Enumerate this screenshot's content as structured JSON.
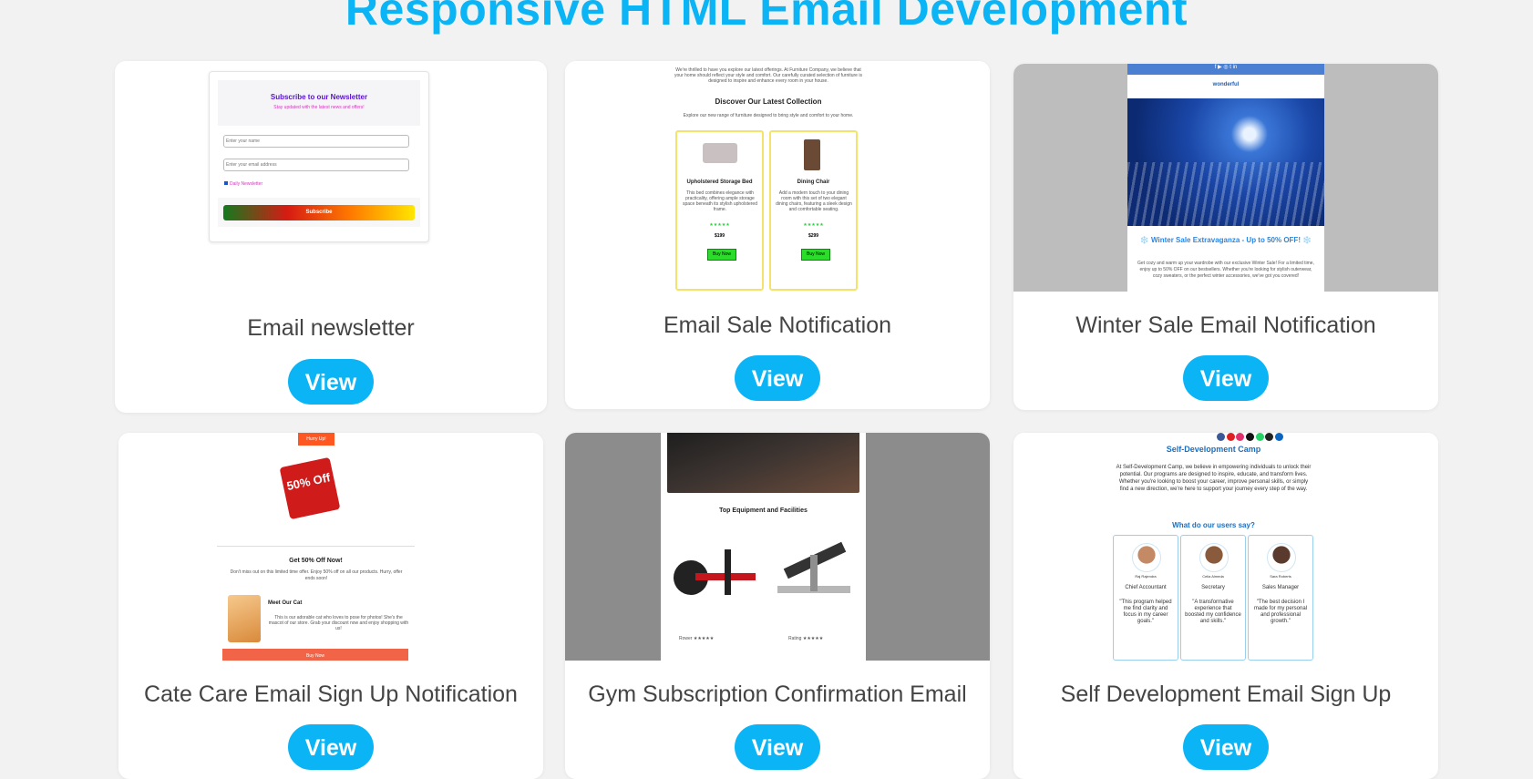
{
  "page": {
    "title": "Responsive HTML Email Development"
  },
  "cards": [
    {
      "title": "Email newsletter",
      "view_label": "View",
      "preview": {
        "heading": "Subscribe to our Newsletter",
        "subheading": "Stay updated with the latest news and offers!",
        "name_placeholder": "Enter your name",
        "email_placeholder": "Enter your email address",
        "checkbox_label": "Daily Newsletter",
        "button": "Subscribe"
      }
    },
    {
      "title": "Email Sale Notification",
      "view_label": "View",
      "preview": {
        "intro": "We're thrilled to have you explore our latest offerings. At Furniture Company, we believe that your home should reflect your style and comfort. Our carefully curated selection of furniture is designed to inspire and enhance every room in your house.",
        "heading": "Discover Our Latest Collection",
        "subtext": "Explore our new range of furniture designed to bring style and comfort to your home.",
        "products": [
          {
            "name": "Upholstered Storage Bed",
            "desc": "This bed combines elegance with practicality, offering ample storage space beneath its stylish upholstered frame.",
            "price": "$199",
            "button": "Buy Now"
          },
          {
            "name": "Dining Chair",
            "desc": "Add a modern touch to your dining room with this set of two elegant dining chairs, featuring a sleek design and comfortable seating.",
            "price": "$299",
            "button": "Buy Now"
          }
        ]
      }
    },
    {
      "title": "Winter Sale Email Notification",
      "view_label": "View",
      "preview": {
        "logo": "wonderful",
        "heading": "❄️ Winter Sale Extravaganza - Up to 50% OFF! ❄️",
        "body": "Get cozy and warm up your wardrobe with our exclusive Winter Sale! For a limited time, enjoy up to 50% OFF on our bestsellers. Whether you're looking for stylish outerwear, cozy sweaters, or the perfect winter accessories, we've got you covered!"
      }
    },
    {
      "title": "Cate Care Email Sign Up Notification",
      "view_label": "View",
      "preview": {
        "badge": "Hurry Up!",
        "tag_text": "50% Off",
        "heading": "Get 50% Off Now!",
        "body": "Don't miss out on this limited time offer. Enjoy 50% off on all our products. Hurry, offer ends soon!",
        "cat_heading": "Meet Our Cat",
        "cat_body": "This is our adorable cat who loves to pose for photos! She's the mascot of our store. Grab your discount now and enjoy shopping with us!",
        "button": "Buy Now"
      }
    },
    {
      "title": "Gym Subscription Confirmation Email",
      "view_label": "View",
      "preview": {
        "heading": "Top Equipment and Facilities",
        "caption_left": "Rower ★★★★★",
        "caption_right": "Rating ★★★★★"
      }
    },
    {
      "title": "Self Development Email Sign Up",
      "view_label": "View",
      "preview": {
        "heading": "Self-Development Camp",
        "body": "At Self-Development Camp, we believe in empowering individuals to unlock their potential. Our programs are designed to inspire, educate, and transform lives. Whether you're looking to boost your career, improve personal skills, or simply find a new direction, we're here to support your journey every step of the way.",
        "testimonials_heading": "What do our users say?",
        "testimonials": [
          {
            "name": "Raj Rajendra",
            "role": "Chief Accountant",
            "quote": "\"This program helped me find clarity and focus in my career goals.\""
          },
          {
            "name": "Celia Almeda",
            "role": "Secretary",
            "quote": "\"A transformative experience that boosted my confidence and skills.\""
          },
          {
            "name": "Sara Roberts",
            "role": "Sales Manager",
            "quote": "\"The best decision I made for my personal and professional growth.\""
          }
        ]
      }
    }
  ],
  "colors": {
    "accent": "#0bb4f5",
    "title_text": "#444444",
    "background": "#f2f2f2"
  }
}
